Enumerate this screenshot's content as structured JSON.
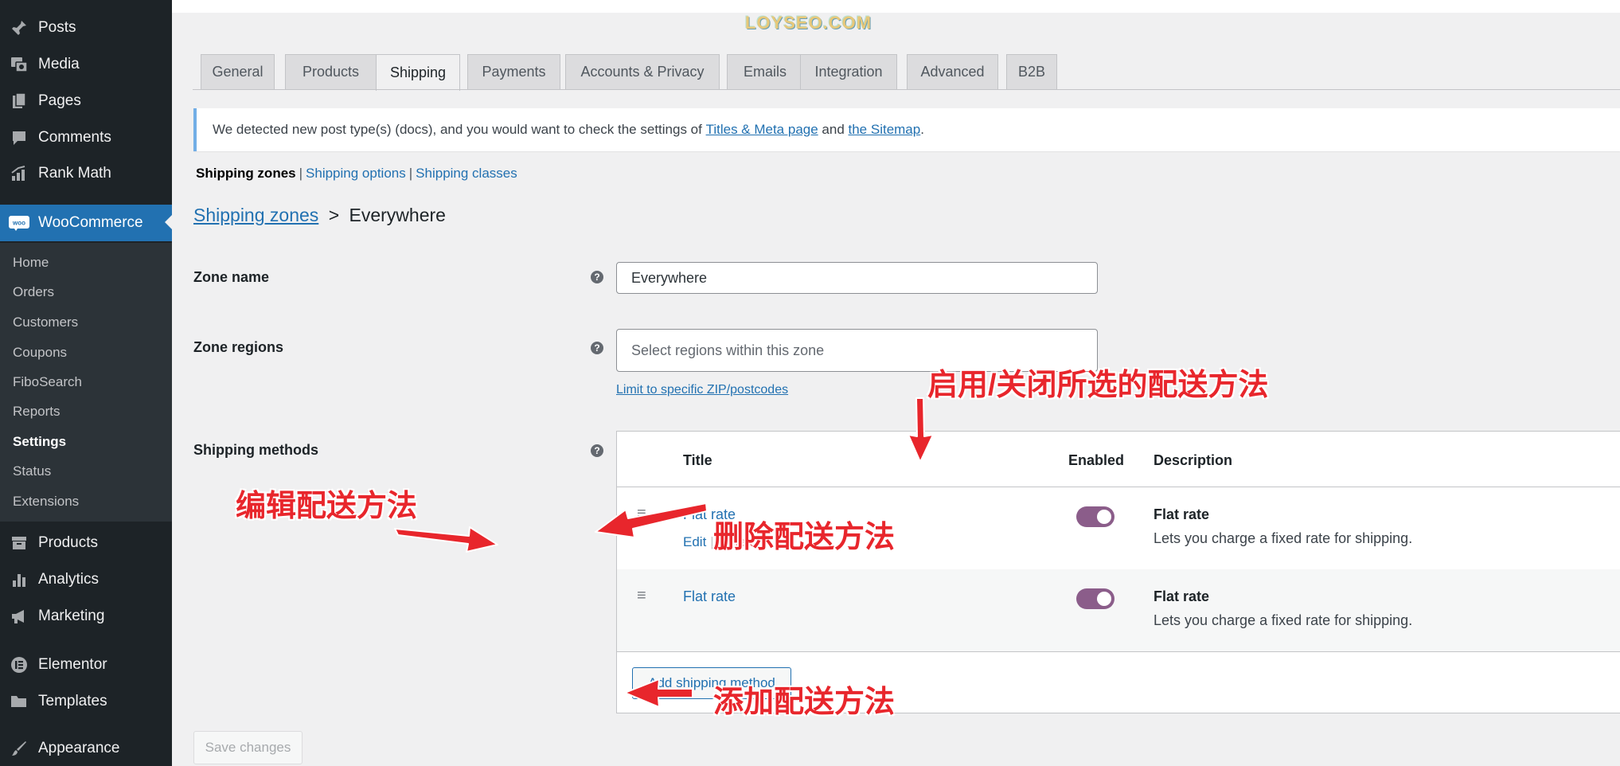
{
  "watermark": "LOYSEO.COM",
  "sidebar": {
    "top_items": [
      {
        "label": "Posts",
        "icon": "pin-icon"
      },
      {
        "label": "Media",
        "icon": "media-icon"
      },
      {
        "label": "Pages",
        "icon": "pages-icon"
      },
      {
        "label": "Comments",
        "icon": "comment-icon"
      },
      {
        "label": "Rank Math",
        "icon": "rank-math-icon"
      }
    ],
    "current": {
      "label": "WooCommerce",
      "icon": "woo-icon"
    },
    "submenu": [
      "Home",
      "Orders",
      "Customers",
      "Coupons",
      "FiboSearch",
      "Reports",
      "Settings",
      "Status",
      "Extensions"
    ],
    "submenu_active": "Settings",
    "bottom_items": [
      {
        "label": "Products",
        "icon": "archive-icon"
      },
      {
        "label": "Analytics",
        "icon": "chart-bar-icon"
      },
      {
        "label": "Marketing",
        "icon": "megaphone-icon"
      },
      {
        "label": "Elementor",
        "icon": "elementor-icon"
      },
      {
        "label": "Templates",
        "icon": "folder-icon"
      },
      {
        "label": "Appearance",
        "icon": "brush-icon"
      }
    ]
  },
  "tabs": [
    "General",
    "Products",
    "Shipping",
    "Payments",
    "Accounts & Privacy",
    "Emails",
    "Integration",
    "Advanced",
    "B2B"
  ],
  "active_tab": "Shipping",
  "notice": {
    "text_before": "We detected new post type(s) (docs), and you would want to check the settings of ",
    "link1": "Titles & Meta page",
    "text_mid": " and ",
    "link2": "the Sitemap",
    "text_after": "."
  },
  "subsections": {
    "current": "Shipping zones",
    "options": "Shipping options",
    "classes": "Shipping classes"
  },
  "breadcrumb": {
    "link": "Shipping zones",
    "separator": ">",
    "current": "Everywhere"
  },
  "form": {
    "zone_name_label": "Zone name",
    "zone_name_value": "Everywhere",
    "zone_regions_label": "Zone regions",
    "zone_regions_placeholder": "Select regions within this zone",
    "zip_link": "Limit to specific ZIP/postcodes",
    "shipping_methods_label": "Shipping methods",
    "help_glyph": "?"
  },
  "methods_table": {
    "headers": {
      "title": "Title",
      "enabled": "Enabled",
      "description": "Description"
    },
    "rows": [
      {
        "title": "Flat rate",
        "edit": "Edit",
        "delete": "Delete",
        "enabled": true,
        "desc_title": "Flat rate",
        "desc_text": "Lets you charge a fixed rate for shipping."
      },
      {
        "title": "Flat rate",
        "enabled": true,
        "desc_title": "Flat rate",
        "desc_text": "Lets you charge a fixed rate for shipping."
      }
    ],
    "add_button": "Add shipping method"
  },
  "save_button": "Save changes",
  "annotations": {
    "toggle_note": "启用/关闭所选的配送方法",
    "edit_note": "编辑配送方法",
    "delete_note": "删除配送方法",
    "add_note": "添加配送方法"
  },
  "colors": {
    "accent": "#2271b1",
    "sidebar_bg": "#1d2327",
    "toggle_on": "#8b5d8a",
    "annotation_red": "#e8262c",
    "delete_red": "#d63638"
  }
}
